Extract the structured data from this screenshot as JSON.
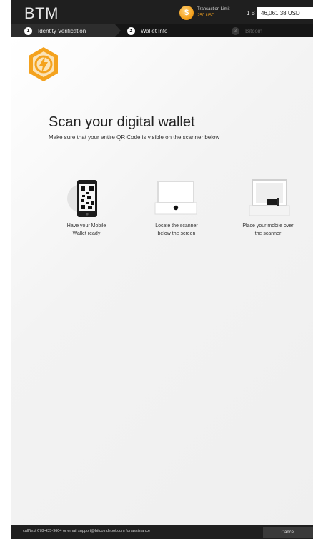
{
  "header": {
    "brand": "BTM",
    "limit_label": "Transaction Limit",
    "limit_value": "250 USD",
    "btc_label": "1 BTC",
    "btc_price": "46,061.38 USD"
  },
  "steps": [
    {
      "number": "1",
      "label": "Identity Verification",
      "state": "active"
    },
    {
      "number": "2",
      "label": "Wallet Info",
      "state": "current"
    },
    {
      "number": "3",
      "label": "Bitcoin",
      "state": "inactive"
    }
  ],
  "main": {
    "title": "Scan your digital wallet",
    "subtitle": "Make sure that your entire QR Code is visible on the scanner below",
    "instructions": [
      {
        "line1": "Have your Mobile",
        "line2": "Wallet ready"
      },
      {
        "line1": "Locate the scanner",
        "line2": "below the screen"
      },
      {
        "line1": "Place your mobile over",
        "line2": "the scanner"
      }
    ]
  },
  "footer": {
    "help": "call/text 678-435-9604 or email support@bitcoindepot.com for assistance",
    "cancel": "Cancel"
  },
  "colors": {
    "accent": "#f4a21e",
    "header_bg": "#1f1f1f",
    "content_bg": "#f2f2f2"
  }
}
